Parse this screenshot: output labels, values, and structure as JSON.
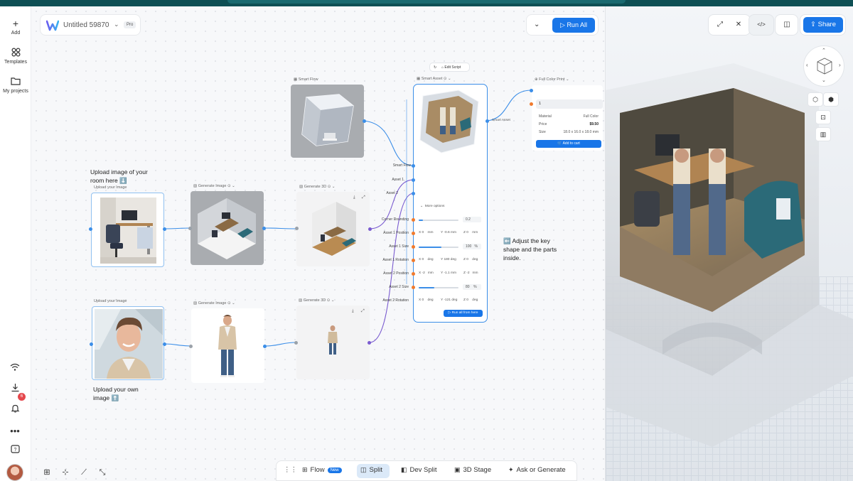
{
  "app": {
    "project_title": "Untitled 59870",
    "plan_badge": "Pro",
    "run_all_label": "Run All",
    "share_label": "Share"
  },
  "rail": {
    "items": [
      {
        "label": "Add",
        "icon": "plus-icon"
      },
      {
        "label": "Templates",
        "icon": "grid-icon"
      },
      {
        "label": "My projects",
        "icon": "folder-icon"
      }
    ],
    "notification_count": "6"
  },
  "nodes": {
    "upload_room": {
      "label": "Upload your Image"
    },
    "upload_person": {
      "label": "Upload your Image"
    },
    "gen_image_1": {
      "label": "Generate Image"
    },
    "gen_image_2": {
      "label": "Generate Image"
    },
    "gen_3d_1": {
      "label": "Generate 3D"
    },
    "gen_3d_2": {
      "label": "Generate 3D"
    },
    "smart_flow": {
      "label": "Smart Flow"
    },
    "smart_asset": {
      "label": "Smart Asset",
      "edit_script": "Edit Script",
      "output_label": "Smart Asset"
    },
    "full_color_print": {
      "label": "Full Color Print"
    }
  },
  "notes": {
    "room_line1": "Upload image of your",
    "room_line2": "room here ⬇️",
    "person_line1": "Upload your own",
    "person_line2": "image ⬆️",
    "adjust_line1": "⬅️ Adjust the key",
    "adjust_line2": "shape and the parts",
    "adjust_line3": "inside."
  },
  "smart_asset_fields": {
    "inputs": [
      "Smart Flow",
      "Asset 1",
      "Asset 2"
    ],
    "more_options": "More options",
    "corner_rounding": {
      "label": "Corner Rounding",
      "value": "0.2"
    },
    "asset1_position": {
      "label": "Asset 1 Position",
      "x": "X 0",
      "xu": "mm",
      "y": "Y -0.6 mm",
      "z": "Z 0",
      "zu": "mm"
    },
    "asset1_size": {
      "label": "Asset 1 Size",
      "value": "100",
      "unit": "%"
    },
    "asset1_rotation": {
      "label": "Asset 1 Rotation",
      "x": "X 0",
      "xu": "deg",
      "y": "Y 180 deg",
      "z": "Z 0",
      "zu": "deg"
    },
    "asset2_position": {
      "label": "Asset 2 Position",
      "x": "X -2",
      "xu": "mm",
      "y": "Y -1.1 mm",
      "z": "Z -2",
      "zu": "mm"
    },
    "asset2_size": {
      "label": "Asset 2 Size",
      "value": "80",
      "unit": "%"
    },
    "asset2_rotation": {
      "label": "Asset 2 Rotation",
      "x": "X 0",
      "xu": "deg",
      "y": "Y -121 deg",
      "z": "Z 0",
      "zu": "deg"
    },
    "run_all_from_here": "Run all from here"
  },
  "print_card": {
    "quantity": "1",
    "rows": [
      {
        "label": "Material",
        "value": "Full Color"
      },
      {
        "label": "Price",
        "value": "$9.50"
      },
      {
        "label": "Size",
        "value": "18.0 x 16.0 x 18.0 mm"
      }
    ],
    "add_to_cart": "Add to cart"
  },
  "bottombar": {
    "flow": "Flow",
    "flow_badge": "New",
    "split": "Split",
    "dev_split": "Dev Split",
    "stage_3d": "3D Stage",
    "ask": "Ask or Generate"
  },
  "colors": {
    "accent": "#1976e8",
    "topstrip": "#0e4f54",
    "wire_blue": "#3b8ee8",
    "wire_purple": "#7a5bd0",
    "port_orange": "#f07a2d"
  }
}
